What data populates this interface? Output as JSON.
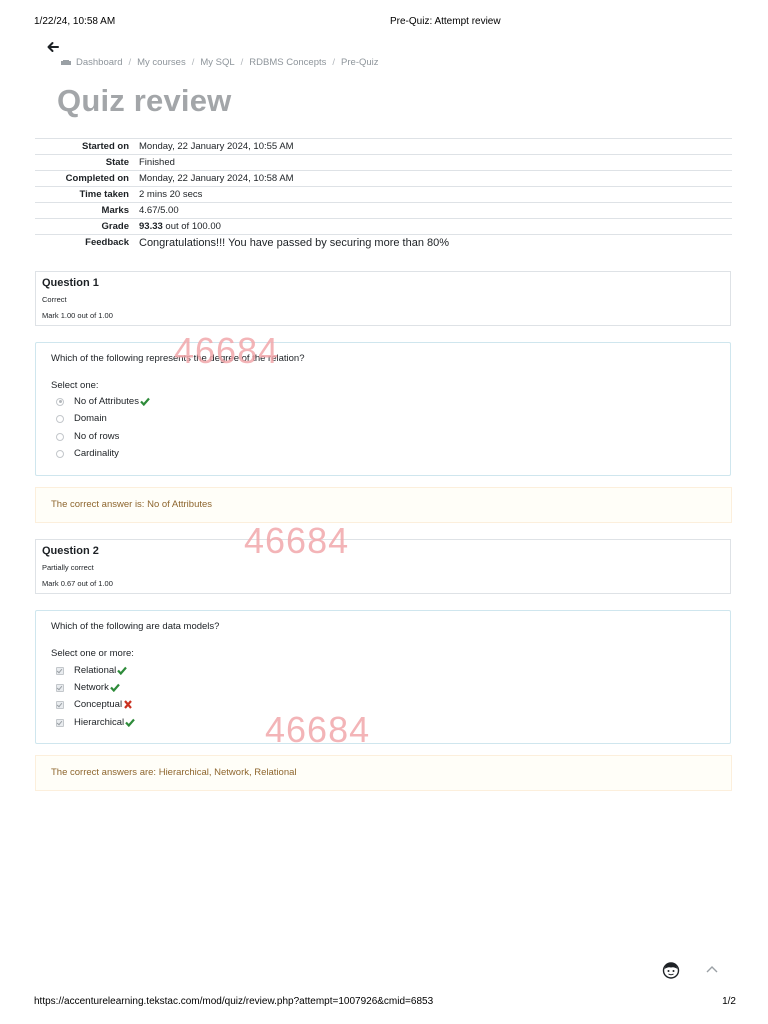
{
  "print": {
    "date": "1/22/24, 10:58 AM",
    "title": "Pre-Quiz: Attempt review",
    "url": "https://accenturelearning.tekstac.com/mod/quiz/review.php?attempt=1007926&cmid=6853",
    "page": "1/2"
  },
  "breadcrumb": [
    "Dashboard",
    "My courses",
    "My SQL",
    "RDBMS Concepts",
    "Pre-Quiz"
  ],
  "page_title": "Quiz review",
  "summary": {
    "started_label": "Started on",
    "started_value": "Monday, 22 January 2024, 10:55 AM",
    "state_label": "State",
    "state_value": "Finished",
    "completed_label": "Completed on",
    "completed_value": "Monday, 22 January 2024, 10:58 AM",
    "time_label": "Time taken",
    "time_value": "2 mins 20 secs",
    "marks_label": "Marks",
    "marks_value": "4.67/5.00",
    "grade_label": "Grade",
    "grade_score": "93.33",
    "grade_rest": " out of 100.00",
    "feedback_label": "Feedback",
    "feedback_value": "Congratulations!!! You have passed by securing more than 80%"
  },
  "q1": {
    "number": "Question 1",
    "state": "Correct",
    "grade": "Mark 1.00 out of 1.00",
    "text": "Which of the following represents the degree of the relation?",
    "prompt": "Select one:",
    "options": [
      {
        "label": "No of Attributes",
        "checked": true,
        "mark": "correct"
      },
      {
        "label": "Domain",
        "checked": false,
        "mark": ""
      },
      {
        "label": "No of rows",
        "checked": false,
        "mark": ""
      },
      {
        "label": "Cardinality",
        "checked": false,
        "mark": ""
      }
    ],
    "right_answer": "The correct answer is: No of Attributes"
  },
  "q2": {
    "number": "Question 2",
    "state": "Partially correct",
    "grade": "Mark 0.67 out of 1.00",
    "text": "Which of the following are data models?",
    "prompt": "Select one or more:",
    "options": [
      {
        "label": "Relational",
        "checked": true,
        "mark": "correct"
      },
      {
        "label": "Network",
        "checked": true,
        "mark": "correct"
      },
      {
        "label": "Conceptual",
        "checked": true,
        "mark": "incorrect"
      },
      {
        "label": "Hierarchical",
        "checked": true,
        "mark": "correct"
      }
    ],
    "right_answer": "The correct answers are: Hierarchical, Network, Relational"
  },
  "watermark": "46684",
  "colors": {
    "correct": "#2e8b3a",
    "incorrect": "#ca3120",
    "watermark": "#f2a7ab",
    "outcome_text": "#8e662e"
  }
}
